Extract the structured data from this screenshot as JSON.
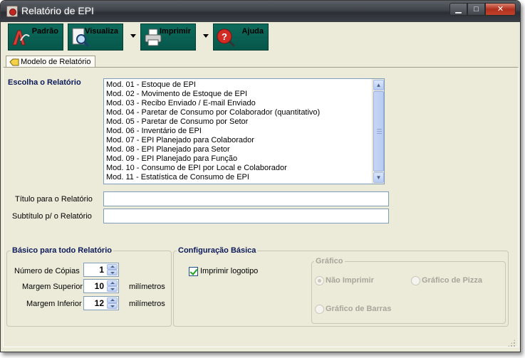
{
  "window": {
    "title": "Relatório de EPI"
  },
  "toolbar": {
    "padrao": "Padrão",
    "visualiza": "Visualiza",
    "imprimir": "Imprimir",
    "ajuda": "Ajuda"
  },
  "tabs": [
    {
      "label": "Modelo de Relatório"
    }
  ],
  "report_list": {
    "label": "Escolha o Relatório",
    "items": [
      "Mod. 01 - Estoque de EPI",
      "Mod. 02 - Movimento de Estoque de EPI",
      "Mod. 03 - Recibo Enviado / E-mail Enviado",
      "Mod. 04 - Paretar de Consumo por Colaborador (quantitativo)",
      "Mod. 05 - Paretar de Consumo por Setor",
      "Mod. 06 - Inventário de EPI",
      "Mod. 07 - EPI Planejado para Colaborador",
      "Mod. 08 - EPI Planejado para Setor",
      "Mod. 09 - EPI Planejado para Função",
      "Mod. 10 - Consumo de EPI por Local e Colaborador",
      "Mod. 11 - Estatística de Consumo de EPI"
    ]
  },
  "form": {
    "titulo_label": "Título para o Relatório",
    "titulo_value": "",
    "subtitulo_label": "Subtítulo p/ o Relatório",
    "subtitulo_value": ""
  },
  "basico": {
    "title": "Básico para todo Relatório",
    "copias_label": "Número de Cópias",
    "copias_value": "1",
    "margem_superior_label": "Margem Superior",
    "margem_superior_value": "10",
    "margem_inferior_label": "Margem Inferior",
    "margem_inferior_value": "12",
    "unit": "milímetros"
  },
  "config": {
    "title": "Configuração Básica",
    "imprimir_logotipo_label": "Imprimir logotipo",
    "imprimir_logotipo_checked": true,
    "grafico": {
      "title": "Gráfico",
      "options": [
        {
          "label": "Não Imprimir",
          "selected": true
        },
        {
          "label": "Gráfico de Pizza",
          "selected": false
        },
        {
          "label": "Gráfico de Barras",
          "selected": false
        }
      ]
    }
  },
  "colors": {
    "toolbar_button": "#0d6b5c",
    "label_accent": "#0b1a5a",
    "window_bg": "#ecead9"
  }
}
